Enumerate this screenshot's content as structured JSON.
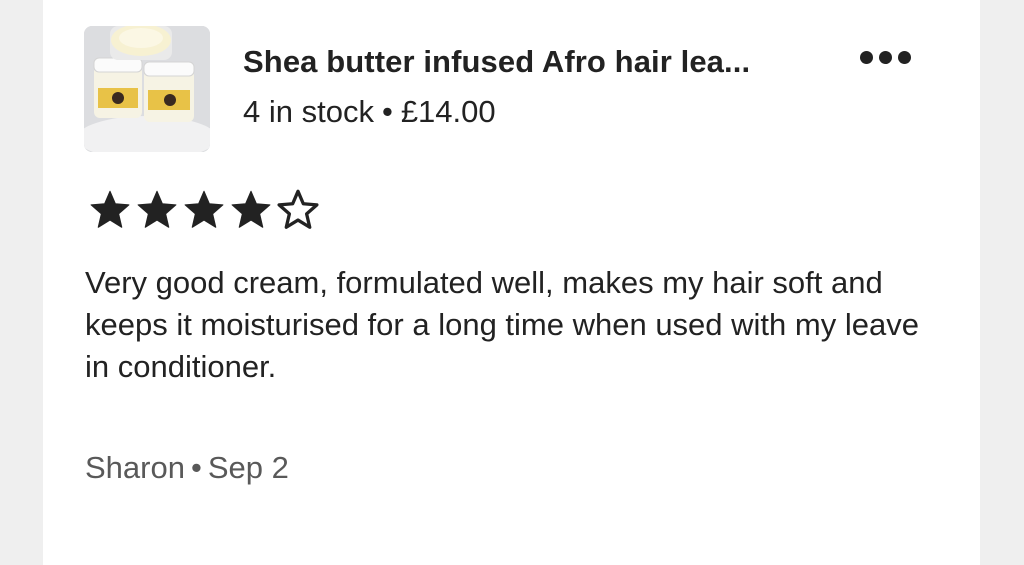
{
  "listing": {
    "title": "Shea butter infused Afro hair lea...",
    "stock": "4 in stock",
    "separator": "•",
    "price": "£14.00",
    "thumbnail_icon": "product-photo-cream-jars"
  },
  "menu": {
    "icon": "more-horizontal-icon"
  },
  "rating": {
    "value": 4,
    "max": 5,
    "filled_icon": "star-filled-icon",
    "empty_icon": "star-outline-icon"
  },
  "review": {
    "text": "Very good cream, formulated well, makes my hair soft and keeps it moisturised for a long time when used with my leave in conditioner."
  },
  "author": {
    "name": "Sharon",
    "separator": "•",
    "date": "Sep 2"
  },
  "colors": {
    "text": "#222222",
    "muted": "#595959",
    "background": "#efefef",
    "card": "#ffffff"
  }
}
